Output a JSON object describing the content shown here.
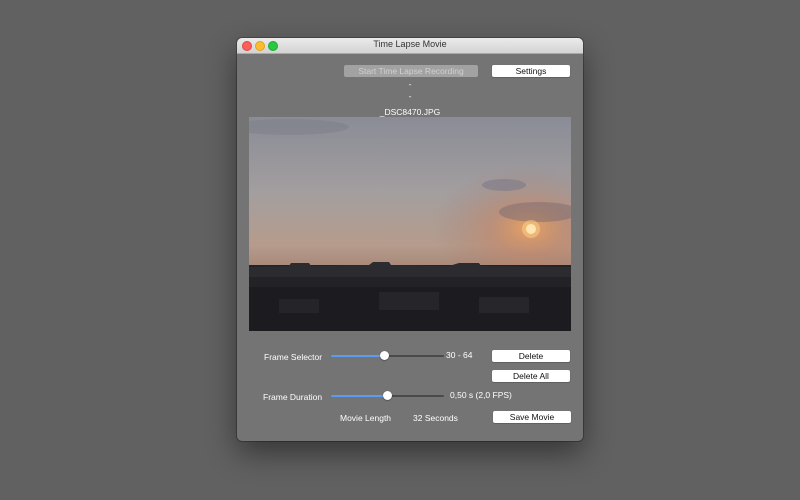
{
  "window": {
    "title": "Time Lapse Movie"
  },
  "toolbar": {
    "start_recording_label": "Start Time Lapse Recording",
    "settings_label": "Settings"
  },
  "status": {
    "line1": "-",
    "line2": "-",
    "filename": "_DSC8470.JPG"
  },
  "frame_selector": {
    "label": "Frame Selector",
    "range_text": "30 - 64",
    "value_fraction": 0.47
  },
  "actions": {
    "delete_label": "Delete",
    "delete_all_label": "Delete All",
    "save_movie_label": "Save Movie"
  },
  "frame_duration": {
    "label": "Frame Duration",
    "value_text": "0,50 s (2,0 FPS)",
    "value_fraction": 0.5
  },
  "movie_length": {
    "label": "Movie Length",
    "value": "32 Seconds"
  },
  "colors": {
    "accent": "#5b9cf3",
    "window_bg": "#747474",
    "desktop_bg": "#616161"
  }
}
